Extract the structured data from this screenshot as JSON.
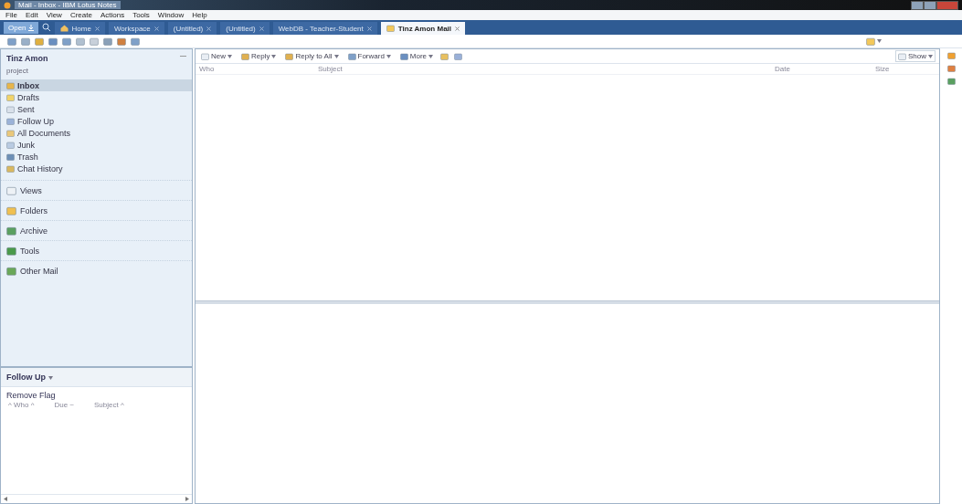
{
  "window": {
    "title": "Mail - Inbox - IBM Lotus Notes"
  },
  "menu": [
    "File",
    "Edit",
    "View",
    "Create",
    "Actions",
    "Tools",
    "Window",
    "Help"
  ],
  "open_button": {
    "label": "Open"
  },
  "tabs": [
    {
      "label": "Home",
      "selected": false
    },
    {
      "label": "Workspace",
      "selected": false
    },
    {
      "label": "(Untitled)",
      "selected": false
    },
    {
      "label": "(Untitled)",
      "selected": false
    },
    {
      "label": "WebDB - Teacher-Student",
      "selected": false
    },
    {
      "label": "Tinz Amon  Mail",
      "selected": true
    }
  ],
  "sidebar": {
    "owner": "Tinz Amon",
    "subtitle": "project",
    "items": [
      {
        "label": "Inbox",
        "selected": true
      },
      {
        "label": "Drafts",
        "selected": false
      },
      {
        "label": "Sent",
        "selected": false
      },
      {
        "label": "Follow Up",
        "selected": false
      },
      {
        "label": "All Documents",
        "selected": false
      },
      {
        "label": "Junk",
        "selected": false
      },
      {
        "label": "Trash",
        "selected": false
      },
      {
        "label": "Chat History",
        "selected": false
      }
    ],
    "sections": [
      "Views",
      "Folders",
      "Archive",
      "Tools",
      "Other Mail"
    ]
  },
  "follow_up": {
    "title": "Follow Up",
    "action": "Remove Flag",
    "columns": [
      "^ Who ^",
      "Due ~",
      "Subject ^"
    ]
  },
  "actions": [
    "New",
    "Reply",
    "Reply to All",
    "Forward",
    "More"
  ],
  "show_button": {
    "label": "Show"
  },
  "view": {
    "columns": [
      "Who",
      "Subject",
      "Date",
      "Size"
    ]
  }
}
